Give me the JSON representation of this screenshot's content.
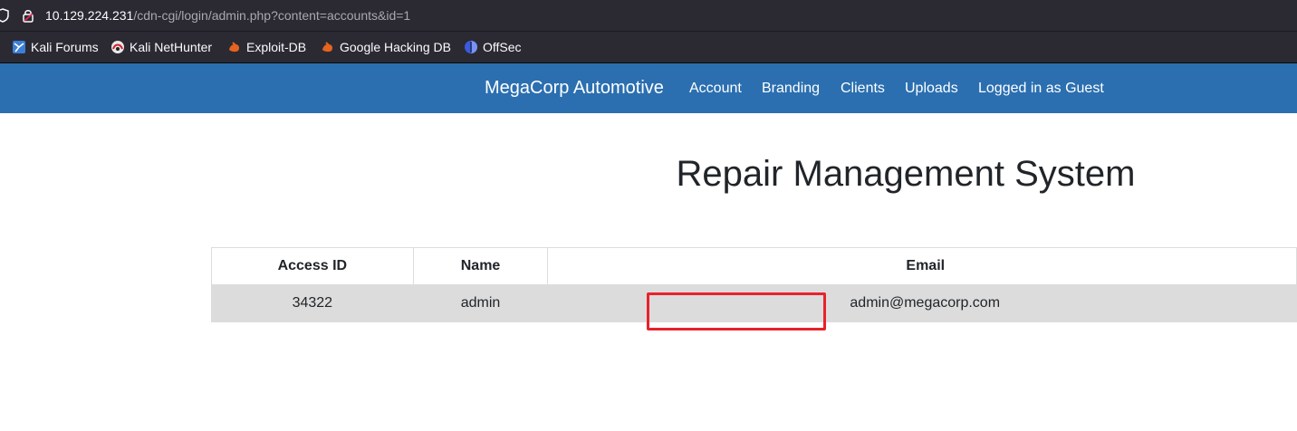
{
  "browser": {
    "url_host": "10.129.224.231",
    "url_path": "/cdn-cgi/login/admin.php?content=accounts&id=1",
    "bookmarks": [
      {
        "label": "Kali Forums",
        "icon": "kali-forums-icon"
      },
      {
        "label": "Kali NetHunter",
        "icon": "kali-nethunter-icon"
      },
      {
        "label": "Exploit-DB",
        "icon": "exploit-db-icon"
      },
      {
        "label": "Google Hacking DB",
        "icon": "google-hacking-db-icon"
      },
      {
        "label": "OffSec",
        "icon": "offsec-icon"
      }
    ]
  },
  "nav": {
    "brand": "MegaCorp Automotive",
    "links": [
      "Account",
      "Branding",
      "Clients",
      "Uploads",
      "Logged in as Guest"
    ],
    "background": "#2b6fb0"
  },
  "main": {
    "title": "Repair Management System",
    "table": {
      "headers": [
        "Access ID",
        "Name",
        "Email"
      ],
      "rows": [
        [
          "34322",
          "admin",
          "admin@megacorp.com"
        ]
      ]
    }
  },
  "annotation": {
    "color": "#e8222b"
  }
}
